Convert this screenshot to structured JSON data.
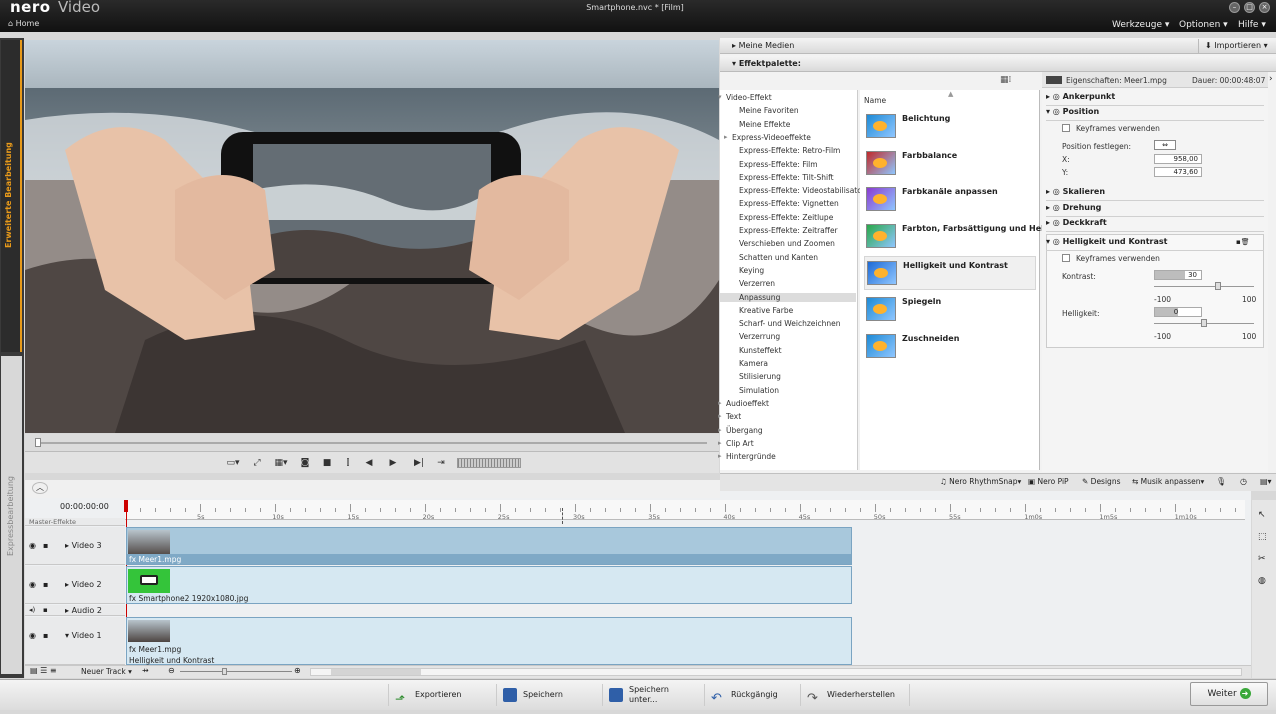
{
  "app": {
    "brand": "nero",
    "product": "Video",
    "window_title": "Smartphone.nvc * [Film]"
  },
  "nav": {
    "home": "Home"
  },
  "menus": [
    {
      "label": "Werkzeuge"
    },
    {
      "label": "Optionen"
    },
    {
      "label": "Hilfe"
    }
  ],
  "side_tabs": {
    "advanced": "Erweiterte Bearbeitung",
    "express": "Expressbearbeitung"
  },
  "panels": {
    "media": "Meine Medien",
    "import": "Importieren",
    "palette": "Effektpalette:"
  },
  "tree": [
    "Video-Effekt",
    "Meine Favoriten",
    "Meine Effekte",
    "Express-Videoeffekte",
    "Express-Effekte: Retro-Film",
    "Express-Effekte: Film",
    "Express-Effekte: Tilt-Shift",
    "Express-Effekte: Videostabilisator",
    "Express-Effekte: Vignetten",
    "Express-Effekte: Zeitlupe",
    "Express-Effekte: Zeitraffer",
    "Verschieben und Zoomen",
    "Schatten und Kanten",
    "Keying",
    "Verzerren",
    "Anpassung",
    "Kreative Farbe",
    "Scharf- und Weichzeichnen",
    "Verzerrung",
    "Kunsteffekt",
    "Kamera",
    "Stilisierung",
    "Simulation",
    "Audioeffekt",
    "Text",
    "Übergang",
    "Clip Art",
    "Hintergründe"
  ],
  "effects": {
    "column_header": "Name",
    "items": [
      "Belichtung",
      "Farbbalance",
      "Farbkanäle anpassen",
      "Farbton, Farbsättigung und Helligk",
      "Helligkeit und Kontrast",
      "Spiegeln",
      "Zuschneiden"
    ]
  },
  "properties": {
    "title": "Eigenschaften: Meer1.mpg",
    "duration": "Dauer: 00:00:48:07",
    "anchor": "Ankerpunkt",
    "position": "Position",
    "keyframes": "Keyframes verwenden",
    "set_position": "Position festlegen:",
    "x_label": "X:",
    "x_value": "958,00",
    "y_label": "Y:",
    "y_value": "473,60",
    "scale": "Skalieren",
    "rotation": "Drehung",
    "opacity": "Deckkraft",
    "brightness_contrast": "Helligkeit und Kontrast",
    "keyframes2": "Keyframes verwenden",
    "contrast_label": "Kontrast:",
    "contrast_value": "30",
    "contrast_min": "-100",
    "contrast_max": "100",
    "brightness_label": "Helligkeit:",
    "brightness_value": "0",
    "brightness_min": "-100",
    "brightness_max": "100"
  },
  "media_bar": [
    "Nero RhythmSnap",
    "Nero PiP",
    "Designs",
    "Musik anpassen"
  ],
  "timeline": {
    "timecode": "00:00:00:00",
    "ticks": [
      "5s",
      "10s",
      "15s",
      "20s",
      "25s",
      "30s",
      "35s",
      "40s",
      "45s",
      "50s",
      "55s",
      "1m0s",
      "1m5s",
      "1m10s"
    ],
    "master": "Master-Effekte",
    "tracks": [
      {
        "name": "Video 3",
        "clip": "Meer1.mpg",
        "sub": ""
      },
      {
        "name": "Video 2",
        "clip": "Smartphone2 1920x1080.jpg",
        "sub": ""
      },
      {
        "name": "Audio 2",
        "clip": "",
        "sub": ""
      },
      {
        "name": "Video 1",
        "clip": "Meer1.mpg",
        "sub": "Helligkeit und Kontrast"
      }
    ],
    "new_track": "Neuer Track",
    "fx": "fx"
  },
  "bottom": {
    "export": "Exportieren",
    "save": "Speichern",
    "save_as": "Speichern unter...",
    "undo": "Rückgängig",
    "redo": "Wiederherstellen",
    "next": "Weiter"
  }
}
